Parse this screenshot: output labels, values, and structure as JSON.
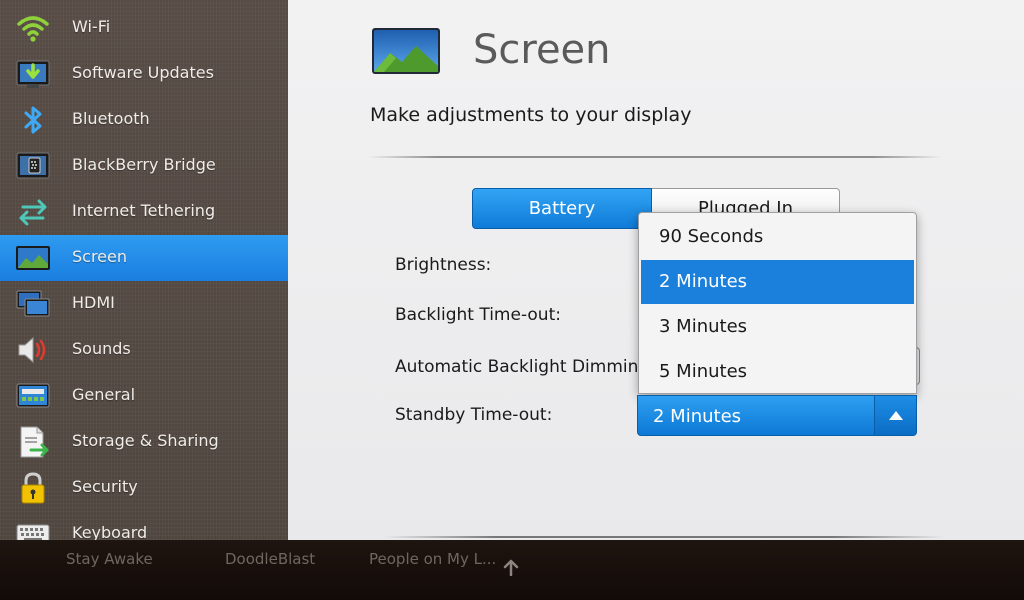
{
  "sidebar": {
    "items": [
      {
        "label": "Wi-Fi",
        "icon": "wifi-icon"
      },
      {
        "label": "Software Updates",
        "icon": "software-update-icon"
      },
      {
        "label": "Bluetooth",
        "icon": "bluetooth-icon"
      },
      {
        "label": "BlackBerry Bridge",
        "icon": "blackberry-bridge-icon"
      },
      {
        "label": "Internet Tethering",
        "icon": "tethering-arrows-icon"
      },
      {
        "label": "Screen",
        "icon": "screen-landscape-icon",
        "active": true
      },
      {
        "label": "HDMI",
        "icon": "hdmi-monitors-icon"
      },
      {
        "label": "Sounds",
        "icon": "speaker-icon"
      },
      {
        "label": "General",
        "icon": "general-device-icon"
      },
      {
        "label": "Storage & Sharing",
        "icon": "storage-document-icon"
      },
      {
        "label": "Security",
        "icon": "lock-icon"
      },
      {
        "label": "Keyboard",
        "icon": "keyboard-icon"
      }
    ]
  },
  "main": {
    "title": "Screen",
    "subtitle": "Make adjustments to your display",
    "tabs": [
      {
        "label": "Battery",
        "selected": true
      },
      {
        "label": "Plugged In",
        "selected": false
      }
    ],
    "settings": {
      "brightness_label": "Brightness:",
      "backlight_timeout_label": "Backlight Time-out:",
      "auto_dimming_label": "Automatic Backlight Dimming",
      "standby_timeout_label": "Standby Time-out:",
      "standby_value": "2 Minutes"
    },
    "dropdown": {
      "options": [
        "90 Seconds",
        "2 Minutes",
        "3 Minutes",
        "5 Minutes"
      ],
      "selected_index": 1
    }
  },
  "taskbar": {
    "items": [
      "Stay Awake",
      "DoodleBlast",
      "People on My L..."
    ]
  },
  "colors": {
    "accent": "#1b7fdc",
    "sidebar_bg": "#5a4f47",
    "main_bg": "#eeeeef",
    "taskbar_bg": "#1a110d"
  }
}
